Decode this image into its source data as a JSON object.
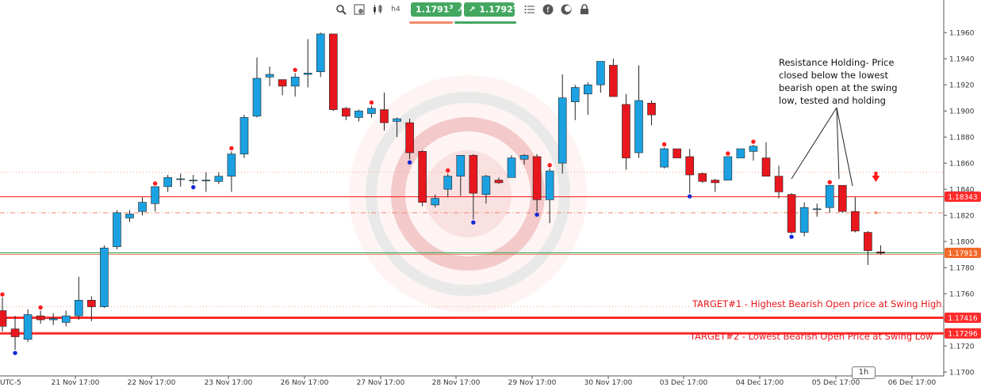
{
  "toolbar": {
    "icons": [
      "zoom-icon",
      "chart-settings-icon",
      "candles-icon",
      "timeframe-icon"
    ],
    "timeframe_icon_text": "h4",
    "sell_price": "1.1791",
    "sell_price_sup": "3",
    "buy_price": "1.1792",
    "buy_price_sup": "5",
    "right_icons": [
      "list-icon",
      "info-icon",
      "theme-icon",
      "lock-icon"
    ],
    "sell_bar_color": "#f08a6a",
    "buy_bar_color": "#43a760"
  },
  "annotation": {
    "lines": [
      "Resistance Holding- Price",
      "closed below the lowest",
      "bearish open at the swing",
      "low, tested and holding"
    ]
  },
  "targets": {
    "target1": "TARGET#1 - Highest Bearish Open price at Swing High",
    "target2": "TARGET#2 - Lowest Bearish Open Price at Swing Low"
  },
  "timeframe_badge": "1h",
  "colors": {
    "bull": "#1ba1e2",
    "bear": "#e8171e",
    "line_red": "#ff2b2b",
    "current_price": "#f26a2b",
    "green_line": "#43a760"
  },
  "chart_data": {
    "type": "candlestick",
    "timezone_label": "UTC-5",
    "x_tick_labels": [
      "21 Nov 17:00",
      "22 Nov 17:00",
      "23 Nov 17:00",
      "26 Nov 17:00",
      "27 Nov 17:00",
      "28 Nov 17:00",
      "29 Nov 17:00",
      "30 Nov 17:00",
      "03 Dec 17:00",
      "04 Dec 17:00",
      "05 Dec 17:00",
      "06 Dec 17:00"
    ],
    "y_tick_labels": [
      "1.1960",
      "1.1940",
      "1.1920",
      "1.1900",
      "1.1880",
      "1.1860",
      "1.1840",
      "1.1820",
      "1.1800",
      "1.1780",
      "1.1760",
      "1.1740",
      "1.1720",
      "1.1700"
    ],
    "y_ticks": [
      1.196,
      1.194,
      1.192,
      1.19,
      1.188,
      1.186,
      1.184,
      1.182,
      1.18,
      1.178,
      1.176,
      1.174,
      1.172,
      1.17
    ],
    "ylim": [
      1.1697,
      1.1985
    ],
    "price_tags": [
      {
        "label": "1.18343",
        "value": 1.18343,
        "color": "#ff2b2b"
      },
      {
        "label": "1.17913",
        "value": 1.17913,
        "color": "#f26a2b"
      },
      {
        "label": "1.17416",
        "value": 1.17416,
        "color": "#ff2b2b"
      },
      {
        "label": "1.17296",
        "value": 1.17296,
        "color": "#ff2b2b"
      }
    ],
    "levels": [
      {
        "name": "resistance",
        "value": 1.18343,
        "style": "solid-red"
      },
      {
        "name": "current-price",
        "value": 1.17913,
        "style": "solid-green"
      },
      {
        "name": "target1",
        "value": 1.17416,
        "style": "thick-red"
      },
      {
        "name": "target2",
        "value": 1.17296,
        "style": "thick-red"
      },
      {
        "name": "dotted-upper",
        "value": 1.1853,
        "style": "dotted-orange"
      },
      {
        "name": "dashdot",
        "value": 1.1822,
        "style": "dashdot-orange"
      },
      {
        "name": "dotted-lower",
        "value": 1.175,
        "style": "dotted-orange"
      }
    ],
    "candles": [
      [
        1.1747,
        1.1757,
        1.1731,
        1.1735
      ],
      [
        1.1733,
        1.1743,
        1.1717,
        1.1727
      ],
      [
        1.1725,
        1.1748,
        1.1723,
        1.1744
      ],
      [
        1.1743,
        1.1747,
        1.1737,
        1.174
      ],
      [
        1.174,
        1.1745,
        1.1736,
        1.1741
      ],
      [
        1.1738,
        1.1747,
        1.1735,
        1.1743
      ],
      [
        1.1743,
        1.1773,
        1.174,
        1.1755
      ],
      [
        1.1755,
        1.1758,
        1.1739,
        1.175
      ],
      [
        1.175,
        1.1797,
        1.1749,
        1.1795
      ],
      [
        1.1796,
        1.1824,
        1.1794,
        1.1822
      ],
      [
        1.1818,
        1.1824,
        1.1815,
        1.1821
      ],
      [
        1.1823,
        1.1834,
        1.182,
        1.183
      ],
      [
        1.1829,
        1.1842,
        1.1823,
        1.1842
      ],
      [
        1.1842,
        1.1851,
        1.1838,
        1.1849
      ],
      [
        1.1848,
        1.1852,
        1.1842,
        1.1848
      ],
      [
        1.1847,
        1.1851,
        1.1844,
        1.1847
      ],
      [
        1.1847,
        1.1853,
        1.1838,
        1.1847
      ],
      [
        1.1846,
        1.1853,
        1.1844,
        1.185
      ],
      [
        1.185,
        1.1869,
        1.1838,
        1.1867
      ],
      [
        1.1867,
        1.1897,
        1.1864,
        1.1895
      ],
      [
        1.1896,
        1.1941,
        1.1895,
        1.1925
      ],
      [
        1.1926,
        1.1934,
        1.1919,
        1.1928
      ],
      [
        1.1924,
        1.1924,
        1.1912,
        1.1919
      ],
      [
        1.1919,
        1.1929,
        1.1911,
        1.1926
      ],
      [
        1.1928,
        1.1955,
        1.1918,
        1.1929
      ],
      [
        1.193,
        1.196,
        1.1926,
        1.1959
      ],
      [
        1.1959,
        1.1959,
        1.19,
        1.1901
      ],
      [
        1.1902,
        1.1903,
        1.1893,
        1.1896
      ],
      [
        1.1895,
        1.1901,
        1.1892,
        1.19
      ],
      [
        1.1898,
        1.1904,
        1.1895,
        1.1902
      ],
      [
        1.1901,
        1.1914,
        1.1885,
        1.1891
      ],
      [
        1.1892,
        1.1895,
        1.188,
        1.1894
      ],
      [
        1.1891,
        1.1894,
        1.1863,
        1.1868
      ],
      [
        1.1869,
        1.187,
        1.1827,
        1.183
      ],
      [
        1.1828,
        1.1836,
        1.1826,
        1.1833
      ],
      [
        1.184,
        1.1852,
        1.1834,
        1.185
      ],
      [
        1.185,
        1.1866,
        1.1835,
        1.1866
      ],
      [
        1.1866,
        1.1867,
        1.1817,
        1.1837
      ],
      [
        1.1836,
        1.1851,
        1.1829,
        1.185
      ],
      [
        1.1847,
        1.1849,
        1.1844,
        1.1845
      ],
      [
        1.1849,
        1.1866,
        1.1849,
        1.1864
      ],
      [
        1.1863,
        1.1867,
        1.1859,
        1.1866
      ],
      [
        1.1865,
        1.1867,
        1.1823,
        1.1832
      ],
      [
        1.1832,
        1.1856,
        1.1814,
        1.1854
      ],
      [
        1.186,
        1.1928,
        1.1852,
        1.191
      ],
      [
        1.1907,
        1.192,
        1.1893,
        1.1918
      ],
      [
        1.1913,
        1.1922,
        1.1897,
        1.192
      ],
      [
        1.192,
        1.1935,
        1.1914,
        1.1938
      ],
      [
        1.1935,
        1.194,
        1.1912,
        1.1911
      ],
      [
        1.1905,
        1.1913,
        1.1855,
        1.1864
      ],
      [
        1.1868,
        1.1935,
        1.1864,
        1.1908
      ],
      [
        1.1906,
        1.1908,
        1.1889,
        1.1897
      ],
      [
        1.1857,
        1.1872,
        1.1856,
        1.1871
      ],
      [
        1.1871,
        1.1871,
        1.1864,
        1.1864
      ],
      [
        1.1865,
        1.1871,
        1.1837,
        1.1851
      ],
      [
        1.1852,
        1.1853,
        1.1845,
        1.1846
      ],
      [
        1.1847,
        1.1848,
        1.1838,
        1.1845
      ],
      [
        1.1847,
        1.1865,
        1.1847,
        1.1865
      ],
      [
        1.1864,
        1.187,
        1.1864,
        1.1871
      ],
      [
        1.1869,
        1.1874,
        1.1862,
        1.1873
      ],
      [
        1.1864,
        1.1876,
        1.185,
        1.185
      ],
      [
        1.185,
        1.1858,
        1.1833,
        1.1838
      ],
      [
        1.1836,
        1.1837,
        1.1806,
        1.1807
      ],
      [
        1.1807,
        1.183,
        1.1804,
        1.1826
      ],
      [
        1.1825,
        1.1829,
        1.1819,
        1.1825
      ],
      [
        1.1826,
        1.1843,
        1.1822,
        1.1843
      ],
      [
        1.1843,
        1.1843,
        1.1822,
        1.1823
      ],
      [
        1.1823,
        1.1834,
        1.1807,
        1.1808
      ],
      [
        1.1807,
        1.1808,
        1.1782,
        1.1793
      ],
      [
        1.1792,
        1.1797,
        1.179,
        1.1791
      ]
    ],
    "fractal_highs": [
      0,
      3,
      12,
      18,
      23,
      29,
      35,
      43,
      52,
      57,
      59,
      65
    ],
    "fractal_lows": [
      1,
      15,
      32,
      37,
      42,
      54,
      62
    ],
    "sell_arrow_index": 68
  }
}
